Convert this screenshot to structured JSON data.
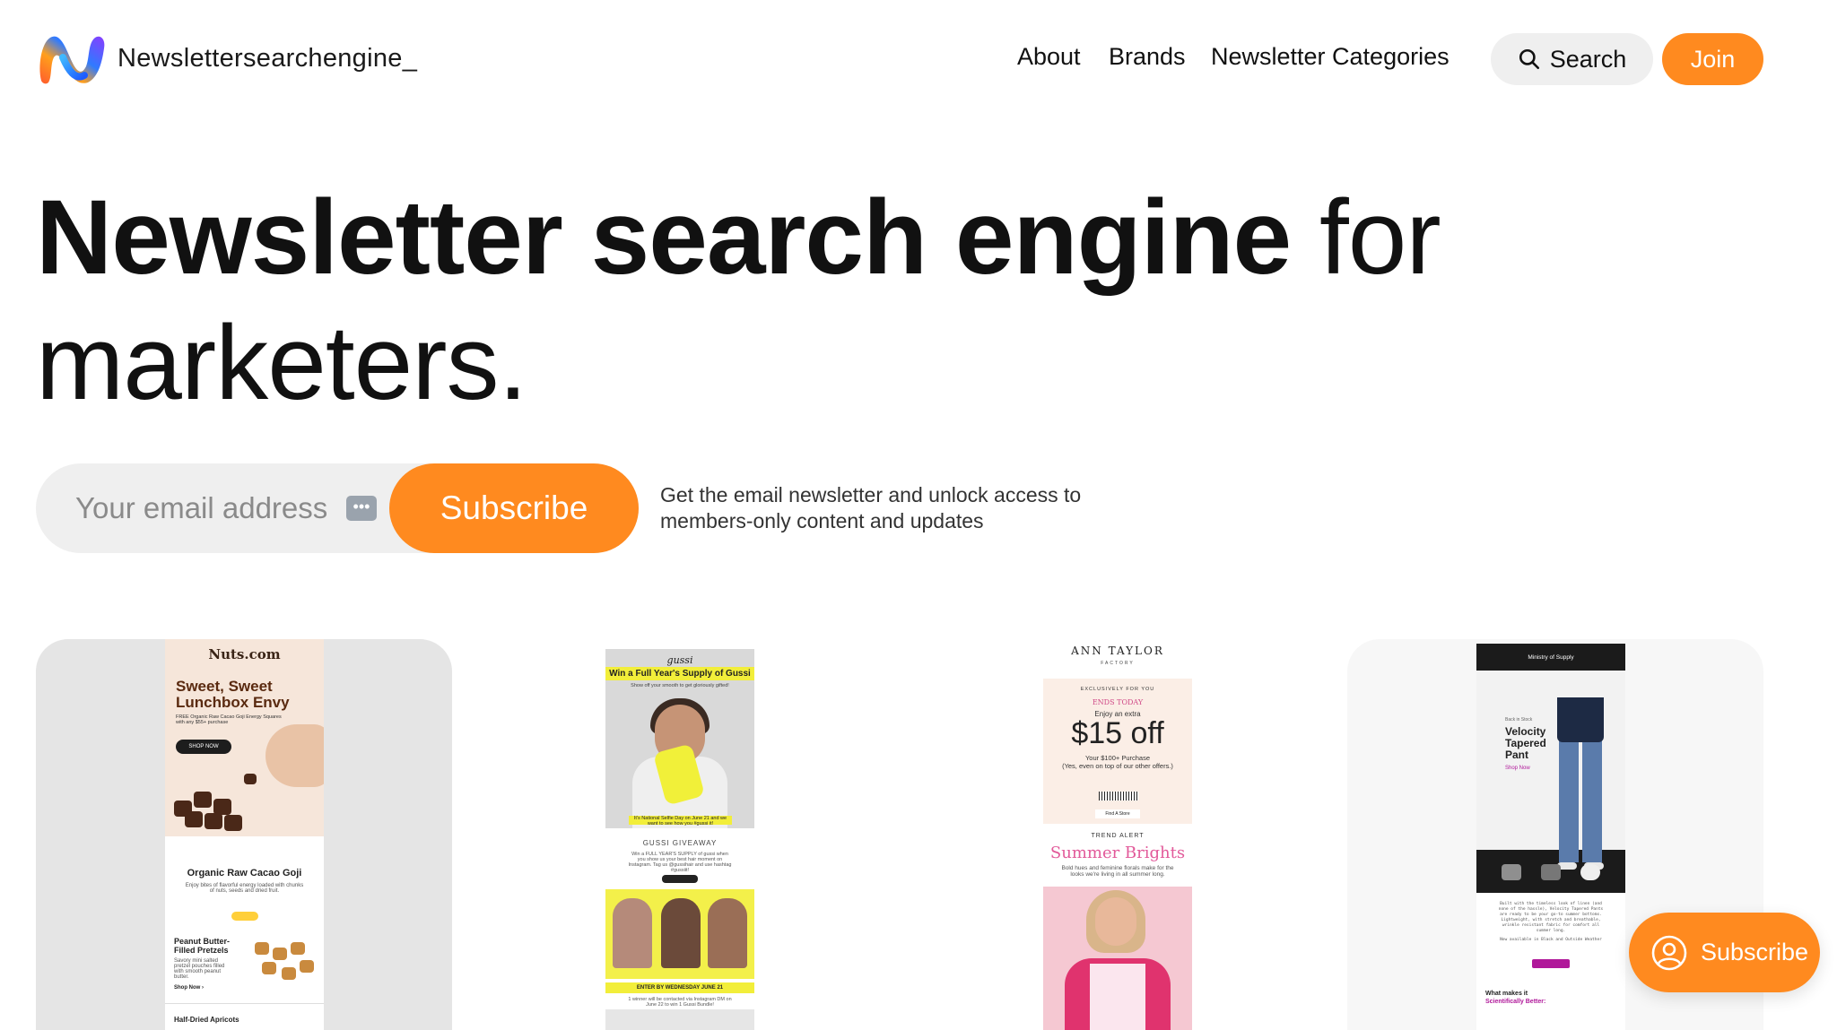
{
  "header": {
    "brand": "Newslettersearchengine_",
    "nav": {
      "about": "About",
      "brands": "Brands",
      "categories": "Newsletter Categories"
    },
    "search_label": "Search",
    "join_label": "Join"
  },
  "hero": {
    "bold": "Newsletter search engine",
    "light1": "for",
    "light2": "marketers."
  },
  "subscribe": {
    "placeholder": "Your email address",
    "button": "Subscribe",
    "description": "Get the email newsletter and unlock access to members-only content and updates"
  },
  "cards": {
    "nuts": {
      "logo": "Nuts.com",
      "headline1": "Sweet, Sweet",
      "headline2": "Lunchbox Envy",
      "promo": "FREE Organic Raw Cacao Goji Energy Squares with any $55+ purchase",
      "shop": "SHOP NOW",
      "item1": "Organic Raw Cacao Goji",
      "item1_desc": "Enjoy bites of flavorful energy loaded with chunks of nuts, seeds and dried fruit.",
      "item2": "Peanut Butter-Filled Pretzels",
      "item2_desc": "Savory mini salted pretzel pouches filled with smooth peanut butter.",
      "item2_shop": "Shop Now ›",
      "item3": "Half-Dried Apricots"
    },
    "gussi": {
      "logo": "gussi",
      "banner": "Win a Full Year's Supply of Gussi",
      "sub": "Show off your smooth to get gloriously gifted!",
      "caption": "It's National Selfie Day on June 21 and we want to see how you #gussi it!",
      "giveaway": "GUSSI GIVEAWAY",
      "enter_by": "ENTER BY WEDNESDAY JUNE 21",
      "winner": "1 winner will be contacted via Instagram DM on June 22 to win 1 Gussi Bundle!"
    },
    "ann": {
      "brand": "ANN TAYLOR",
      "factory": "FACTORY",
      "exclusive": "EXCLUSIVELY FOR YOU",
      "ends": "ENDS TODAY",
      "enjoy": "Enjoy an extra",
      "offer": "$15 off",
      "purchase": "Your $100+ Purchase",
      "even": "(Yes, even on top of our other offers.)",
      "find": "Find A Store",
      "trend": "TREND ALERT",
      "summer": "Summer Brights",
      "desc": "Bold hues and feminine florals make for the looks we're living in all summer long."
    },
    "ministry": {
      "logo": "Ministry of Supply",
      "label": "Back in Stock",
      "title": "Velocity Tapered Pant",
      "shop": "Shop Now",
      "body": "Built with the timeless look of linen (and none of the hassle), Velocity Tapered Pants are ready to be your go-to summer bottoms. Lightweight, with stretch and breathable, wrinkle resistant fabric for comfort all summer long.",
      "avail": "Now available in Black and Outside Weather",
      "what": "What makes it",
      "sci": "Scientifically Better:"
    }
  },
  "float_subscribe": "Subscribe",
  "colors": {
    "accent": "#ff8a1f",
    "pill_bg": "#efefef"
  }
}
